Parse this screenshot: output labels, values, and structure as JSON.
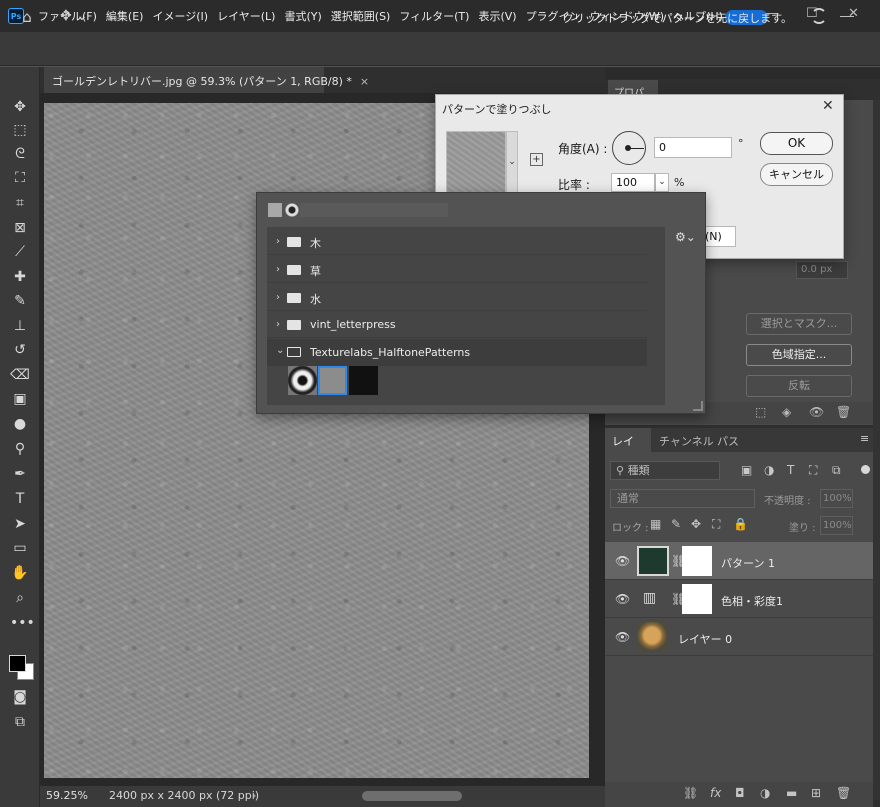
{
  "app": {
    "logo": "Ps"
  },
  "menu": [
    "ファイル(F)",
    "編集(E)",
    "イメージ(I)",
    "レイヤー(L)",
    "書式(Y)",
    "選択範囲(S)",
    "フィルター(T)",
    "表示(V)",
    "プラグイン",
    "ウィンドウ(W)",
    "ヘルプ(H)"
  ],
  "options_bar": {
    "hint": "クリックドラッグでパターンを元に戻します。"
  },
  "document": {
    "tab_title": "ゴールデンレトリバー.jpg @ 59.3% (パターン 1, RGB/8) *",
    "close": "×"
  },
  "status": {
    "zoom": "59.25%",
    "size": "2400 px x 2400 px (72 ppi)",
    "arrow": "›"
  },
  "properties": {
    "tab": "プロパティ",
    "px_value": "0.0 px",
    "select_mask": "選択とマスク...",
    "color_range": "色域指定...",
    "invert": "反転"
  },
  "dialog": {
    "title": "パターンで塗りつぶし",
    "angle_label": "角度(A) :",
    "angle_value": "0",
    "angle_unit": "°",
    "scale_label": "比率 :",
    "scale_value": "100",
    "scale_unit": "%",
    "ok": "OK",
    "cancel": "キャンセル",
    "link_label": "(N)"
  },
  "pattern_picker": {
    "folders": [
      {
        "name": "木",
        "expanded": false
      },
      {
        "name": "草",
        "expanded": false
      },
      {
        "name": "水",
        "expanded": false
      },
      {
        "name": "vint_letterpress",
        "expanded": false
      },
      {
        "name": "Texturelabs_HalftonePatterns",
        "expanded": true
      }
    ],
    "selected_swatch_index": 1
  },
  "layers_panel": {
    "tabs": [
      "レイヤー",
      "チャンネル",
      "パス"
    ],
    "search_placeholder": "種類",
    "blend_mode": "通常",
    "opacity_label": "不透明度 :",
    "opacity_value": "100%",
    "lock_label": "ロック :",
    "fill_label": "塗り :",
    "fill_value": "100%",
    "layers": [
      {
        "name": "パターン 1",
        "selected": true
      },
      {
        "name": "色相・彩度1",
        "selected": false
      },
      {
        "name": "レイヤー 0",
        "selected": false
      }
    ]
  },
  "colors": {
    "accent": "#1473e6",
    "panel": "#4a4a4a",
    "selected_layer": "#656565"
  }
}
